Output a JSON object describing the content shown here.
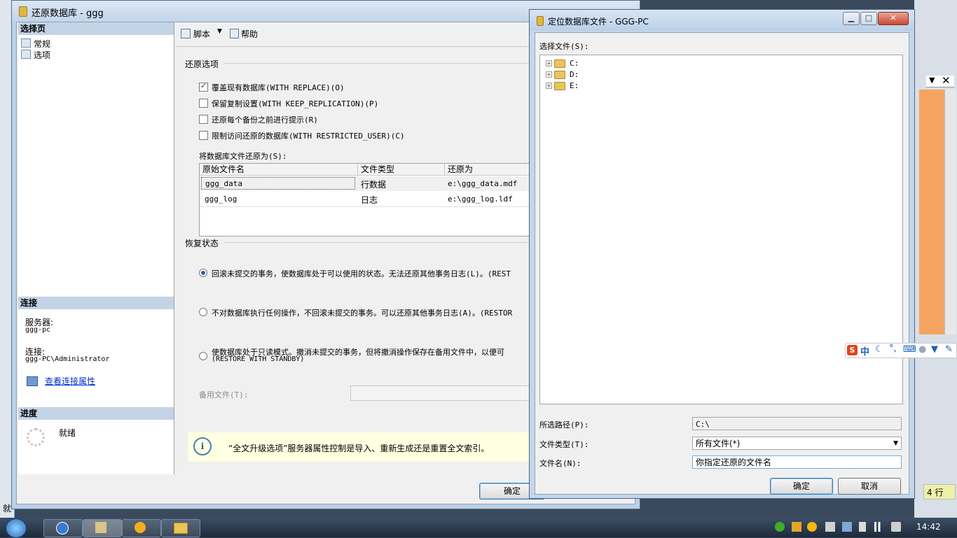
{
  "main_dialog": {
    "title": "还原数据库 - ggg",
    "left_pane": {
      "select_page_header": "选择页",
      "pages": [
        "常规",
        "选项"
      ],
      "connection_header": "连接",
      "server_label": "服务器:",
      "server_value": "ggg-pc",
      "connection_label": "连接:",
      "connection_value": "ggg-PC\\Administrator",
      "view_conn_props": "查看连接属性",
      "progress_header": "进度",
      "progress_status": "就绪"
    },
    "toolbar": {
      "script_label": "脚本",
      "help_label": "帮助"
    },
    "restore_options": {
      "header": "还原选项",
      "checkboxes": [
        {
          "label": "覆盖现有数据库(WITH REPLACE)(O)",
          "checked": true
        },
        {
          "label": "保留复制设置(WITH KEEP_REPLICATION)(P)",
          "checked": false
        },
        {
          "label": "还原每个备份之前进行提示(R)",
          "checked": false
        },
        {
          "label": "限制访问还原的数据库(WITH RESTRICTED_USER)(C)",
          "checked": false
        }
      ],
      "files_label": "将数据库文件还原为(S):",
      "columns": [
        "原始文件名",
        "文件类型",
        "还原为"
      ],
      "rows": [
        {
          "name": "ggg_data",
          "type": "行数据",
          "restore_as": "e:\\ggg_data.mdf"
        },
        {
          "name": "ggg_log",
          "type": "日志",
          "restore_as": "e:\\ggg_log.ldf"
        }
      ]
    },
    "recovery_state": {
      "header": "恢复状态",
      "options": [
        {
          "label": "回滚未提交的事务，使数据库处于可以使用的状态。无法还原其他事务日志(L)。(REST",
          "selected": true
        },
        {
          "label": "不对数据库执行任何操作，不回滚未提交的事务。可以还原其他事务日志(A)。(RESTOR",
          "selected": false
        },
        {
          "label": "使数据库处于只读模式。撤消未提交的事务，但将撤消操作保存在备用文件中，以便可",
          "label2": "(RESTORE WITH STANDBY)",
          "selected": false
        }
      ],
      "standby_label": "备用文件(T):"
    },
    "info_message": "“全文升级选项”服务器属性控制是导入、重新生成还是重置全文索引。",
    "ok_label": "确定"
  },
  "locate_dialog": {
    "title": "定位数据库文件 - GGG-PC",
    "select_file_label": "选择文件(S):",
    "drives": [
      "C:",
      "D:",
      "E:"
    ],
    "selected_path_label": "所选路径(P):",
    "selected_path_value": "C:\\",
    "file_type_label": "文件类型(T):",
    "file_type_value": "所有文件(*)",
    "file_name_label": "文件名(N):",
    "file_name_value": "你指定还原的文件名",
    "ok_label": "确定",
    "cancel_label": "取消"
  },
  "background": {
    "rows_label": "4 行",
    "status_char": "就"
  },
  "ime": {
    "lang": "中"
  },
  "taskbar": {
    "time": "14:42"
  }
}
